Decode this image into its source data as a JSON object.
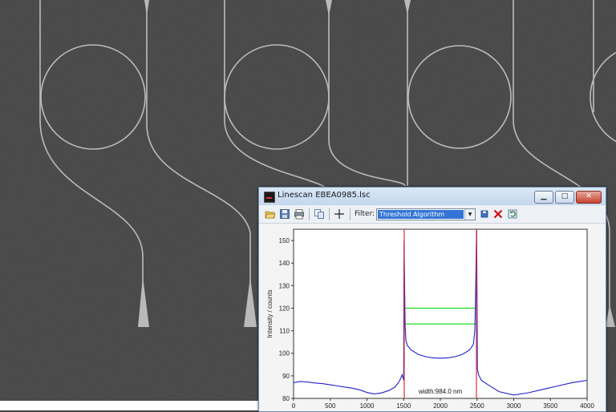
{
  "window": {
    "title": "Linescan EBEA0985.lsc",
    "min_glyph": "▁",
    "max_glyph": "□",
    "close_glyph": "✕"
  },
  "toolbar": {
    "icons": [
      "open-folder-icon",
      "save-icon",
      "print-icon",
      "copy-icon",
      "crosshair-icon",
      "save-small-icon",
      "delete-icon",
      "refresh-icon"
    ],
    "filter_label": "Filter:",
    "filter_value": "Threshold Algorithm",
    "delete_color": "#d01010"
  },
  "chart_data": {
    "type": "line",
    "ylabel": "Intensity / counts",
    "xlabel": "",
    "xlim": [
      0,
      4000
    ],
    "ylim": [
      80,
      155
    ],
    "x_ticks": [
      0,
      500,
      1000,
      1500,
      2000,
      2500,
      3000,
      3500,
      4000
    ],
    "y_ticks": [
      80,
      90,
      100,
      110,
      120,
      130,
      140,
      150
    ],
    "annotation": "width:984.0 nm",
    "edges_x": [
      1508,
      2492
    ],
    "threshold_levels": [
      120,
      113
    ],
    "series": [
      {
        "color": "#2020d0",
        "x": [
          0,
          100,
          200,
          300,
          400,
          500,
          600,
          700,
          800,
          900,
          1000,
          1100,
          1200,
          1300,
          1380,
          1440,
          1480,
          1500,
          1505,
          1510,
          1520,
          1530,
          1550,
          1600,
          1700,
          1800,
          1900,
          2000,
          2100,
          2200,
          2300,
          2400,
          2450,
          2470,
          2480,
          2490,
          2495,
          2500,
          2505,
          2520,
          2560,
          2650,
          2800,
          3000,
          3200,
          3400,
          3600,
          3800,
          3900,
          4000
        ],
        "y": [
          87,
          87.5,
          87.2,
          86.8,
          86.5,
          86,
          85.5,
          85,
          84.5,
          83.8,
          82.6,
          82,
          82.4,
          83.5,
          85,
          87.5,
          90.5,
          88,
          150,
          138,
          112,
          106,
          103.5,
          101.5,
          99.5,
          98.5,
          98,
          97.8,
          98,
          98.5,
          99.5,
          101.5,
          104,
          110,
          125,
          147,
          155,
          120,
          93,
          90.5,
          88,
          86,
          83,
          81.5,
          82.5,
          84,
          85.5,
          87,
          87.5,
          88
        ]
      }
    ]
  }
}
